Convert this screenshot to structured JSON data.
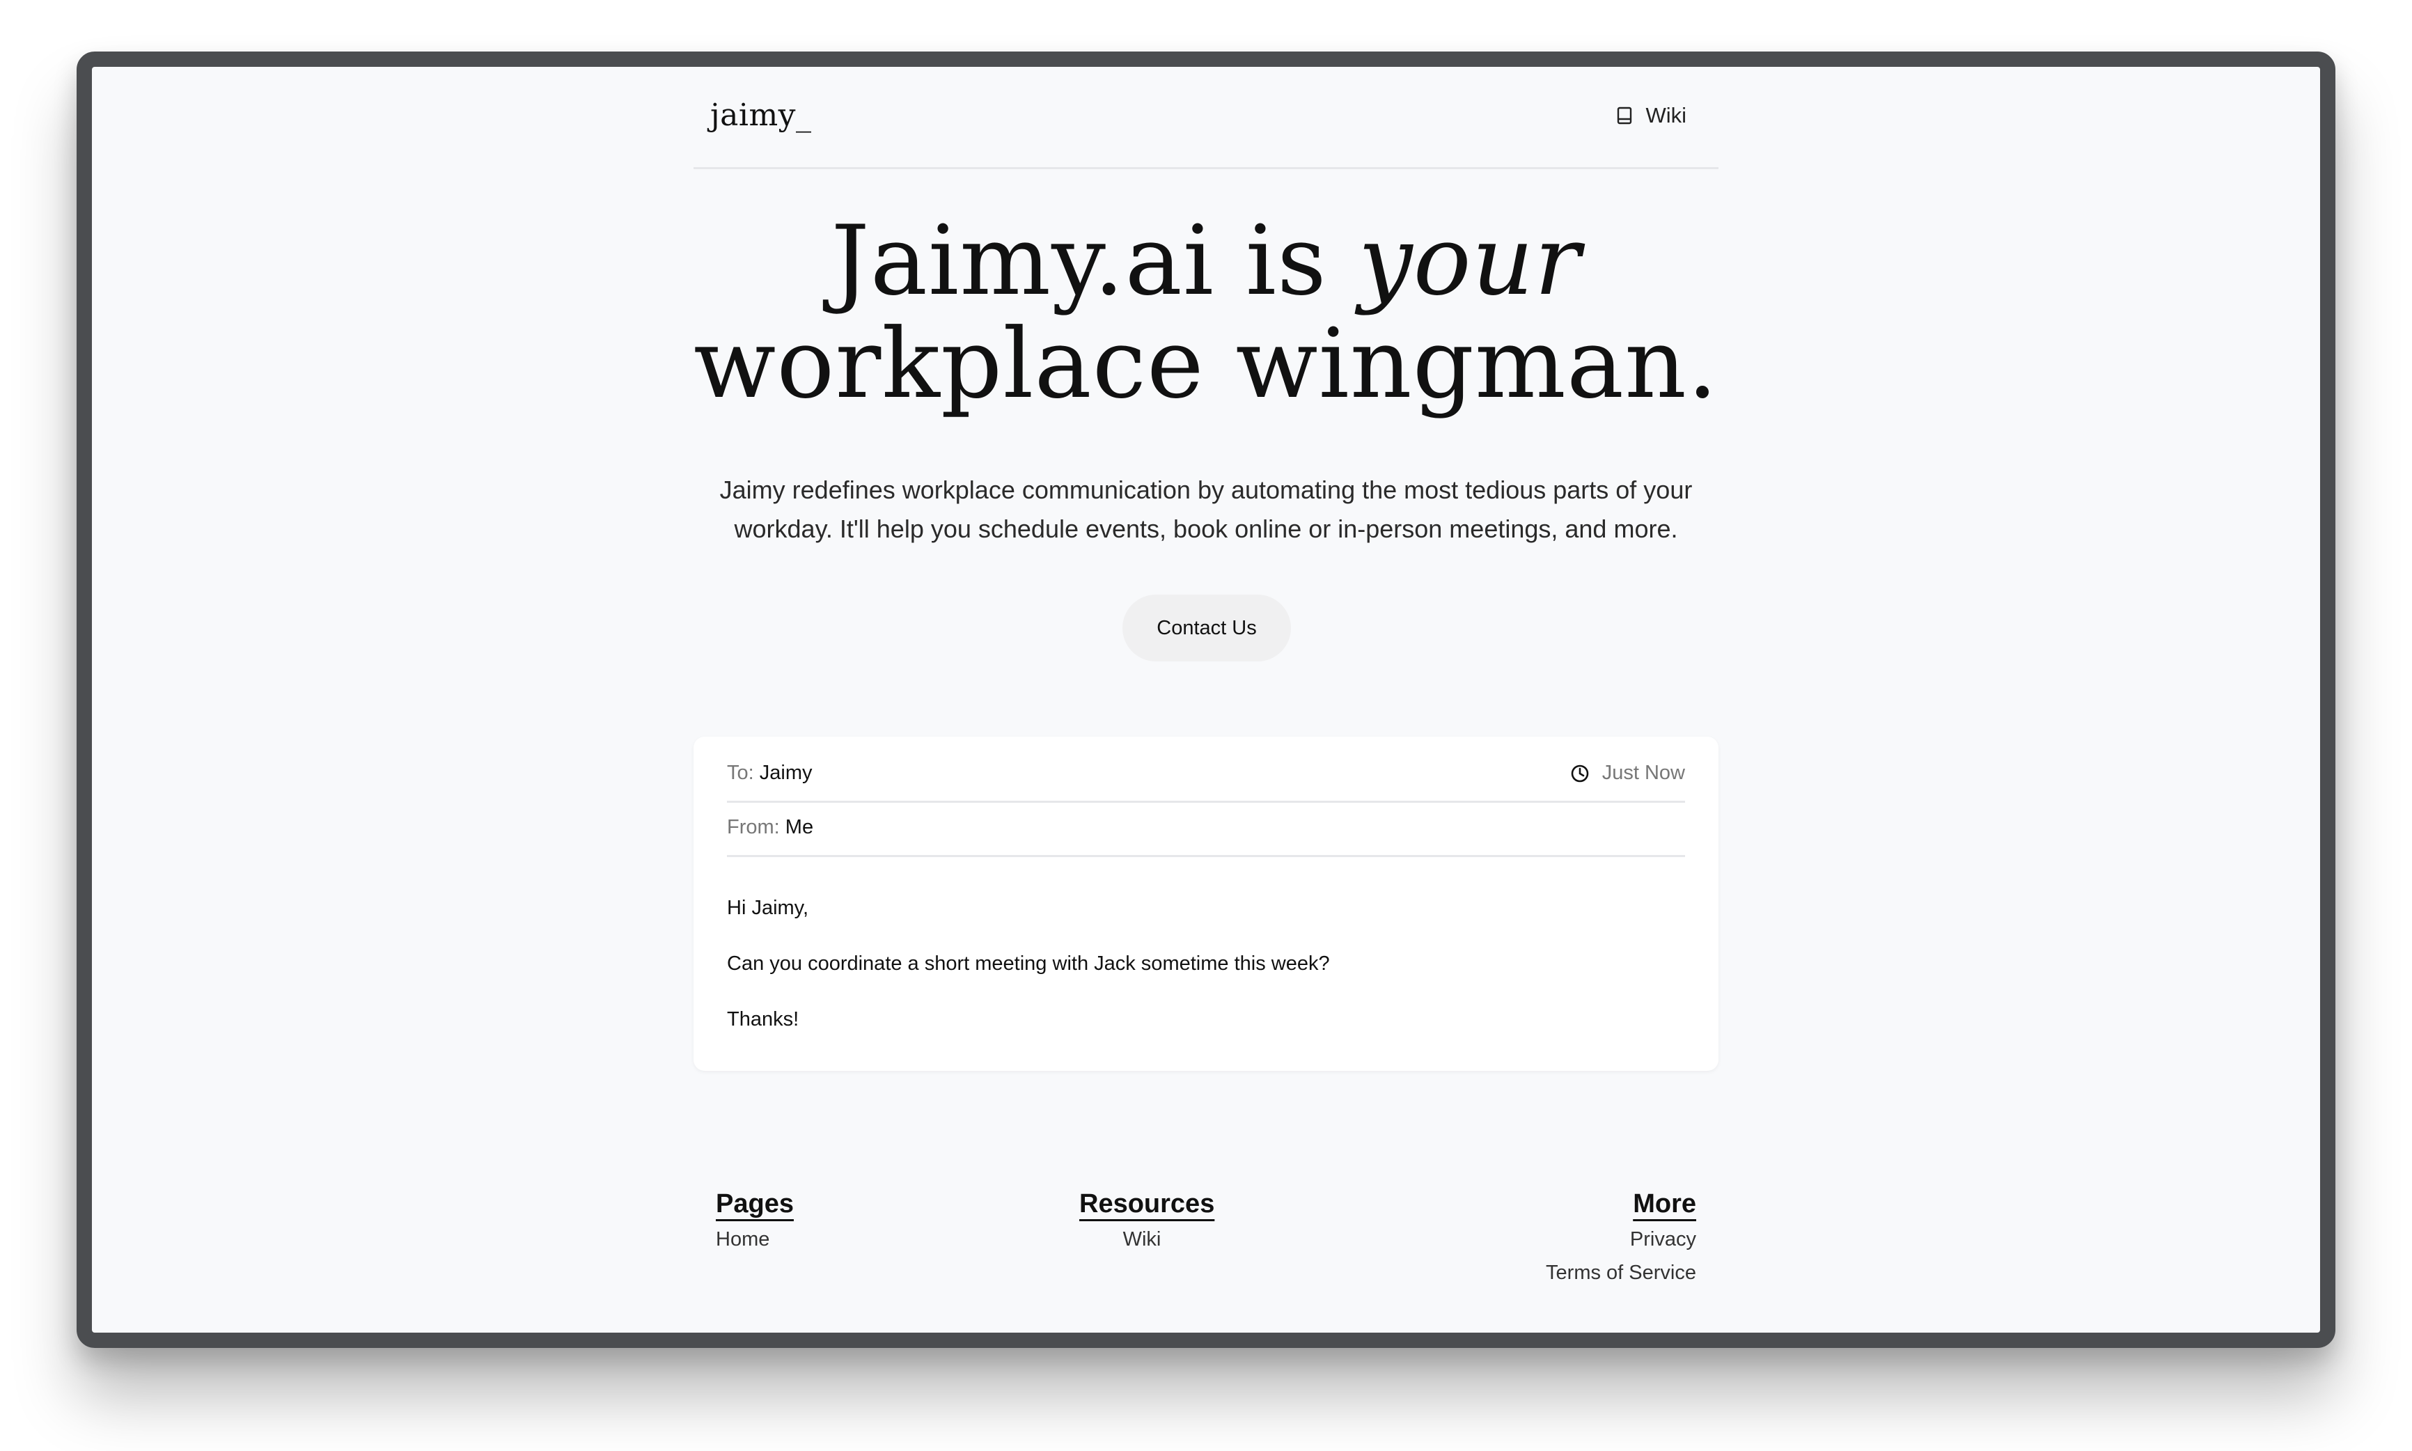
{
  "nav": {
    "logo": "jaimy_",
    "wiki_label": "Wiki",
    "wiki_icon": "book-icon"
  },
  "hero": {
    "title_line1_prefix": "Jaimy.ai is ",
    "title_line1_em": "your",
    "title_line2": "workplace wingman.",
    "subtitle_line1": "Jaimy redefines workplace communication by automating the most tedious parts of your",
    "subtitle_line2": "workday. It'll help you schedule events, book online or in-person meetings, and more.",
    "cta_label": "Contact Us"
  },
  "email": {
    "to_label": "To:",
    "to_value": "Jaimy",
    "from_label": "From:",
    "from_value": "Me",
    "time_icon": "clock-icon",
    "time": "Just Now",
    "greeting": "Hi Jaimy,",
    "message": "Can you coordinate a short meeting with Jack sometime this week?",
    "signoff": "Thanks!"
  },
  "footer": {
    "pages": {
      "heading": "Pages",
      "links": [
        "Home"
      ]
    },
    "resources": {
      "heading": "Resources",
      "links": [
        "Wiki"
      ]
    },
    "more": {
      "heading": "More",
      "links": [
        "Privacy",
        "Terms of Service"
      ]
    }
  },
  "colors": {
    "page_bg": "#f8f9fb",
    "frame": "#4b4d50",
    "card_bg": "#ffffff",
    "button_bg": "#f0f0f1",
    "text": "#111111",
    "muted": "#777777",
    "divider": "#e6e7ea"
  }
}
